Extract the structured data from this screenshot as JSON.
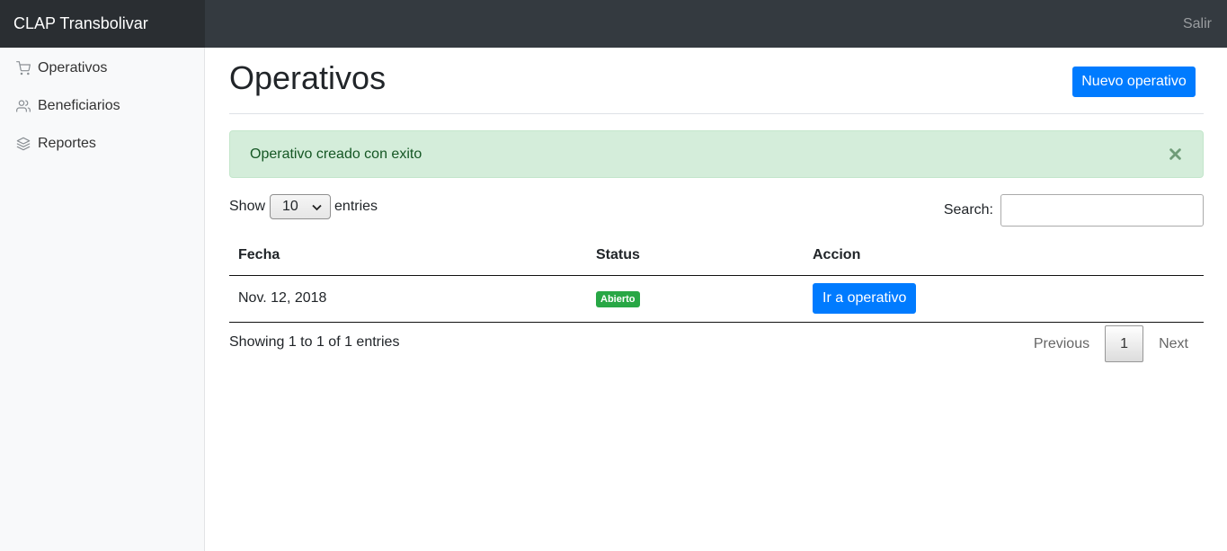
{
  "app": {
    "brand": "CLAP Transbolivar",
    "logout_label": "Salir"
  },
  "sidebar": {
    "items": [
      {
        "label": "Operativos",
        "icon": "cart-icon"
      },
      {
        "label": "Beneficiarios",
        "icon": "users-icon"
      },
      {
        "label": "Reportes",
        "icon": "layers-icon"
      }
    ]
  },
  "main": {
    "title": "Operativos",
    "new_button": "Nuevo operativo",
    "alert": {
      "message": "Operativo creado con exito",
      "close": "×"
    },
    "length": {
      "prefix": "Show",
      "value": "10",
      "suffix": "entries"
    },
    "search": {
      "label": "Search:",
      "value": ""
    },
    "table": {
      "headers": [
        "Fecha",
        "Status",
        "Accion"
      ],
      "rows": [
        {
          "fecha": "Nov. 12, 2018",
          "status": "Abierto",
          "action": "Ir a operativo"
        }
      ]
    },
    "info": "Showing 1 to 1 of 1 entries",
    "pagination": {
      "previous": "Previous",
      "current": "1",
      "next": "Next"
    }
  },
  "colors": {
    "topbar": "#343a40",
    "primary": "#007bff",
    "success": "#28a745",
    "alert_bg": "#d4edda"
  }
}
